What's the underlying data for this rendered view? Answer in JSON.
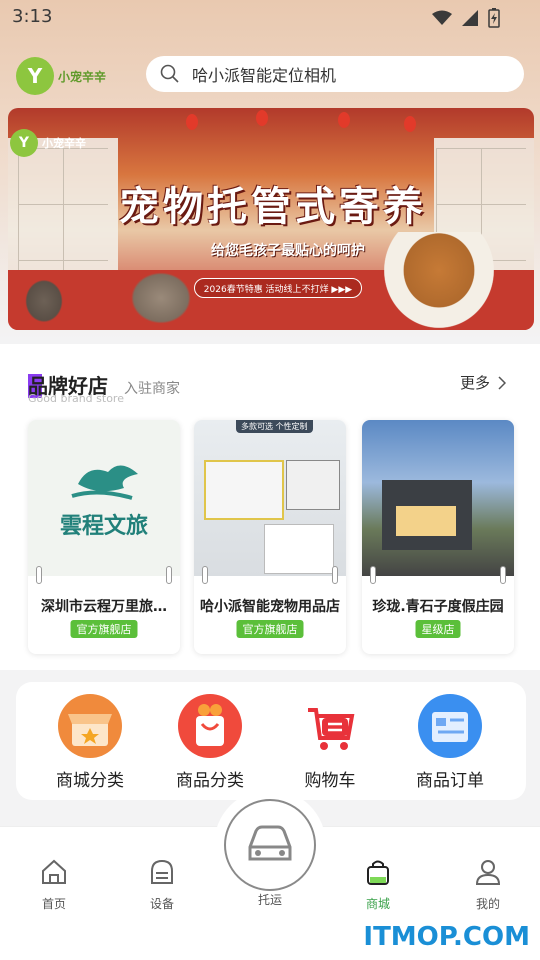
{
  "status_bar": {
    "time": "3:13"
  },
  "header": {
    "logo_text": "小宠辛辛",
    "search_text": "哈小派智能定位相机"
  },
  "banner": {
    "logo_text": "小宠辛辛",
    "title": "宠物托管式寄养",
    "subtitle": "给您毛孩子最贴心的呵护",
    "pill": "2026春节特惠 活动线上不打烊 ▶▶▶"
  },
  "brand": {
    "title": "品牌好店",
    "subtitle": "入驻商家",
    "subtitle_en": "Good brand store",
    "more": "更多",
    "stores": [
      {
        "name": "深圳市云程万里旅…",
        "badge": "官方旗舰店",
        "image_text": "雲程文旅"
      },
      {
        "name": "哈小派智能宠物用品店",
        "badge": "官方旗舰店",
        "image_text": "多款可选 个性定制"
      },
      {
        "name": "珍珑.青石子度假庄园",
        "badge": "星级店",
        "image_text": ""
      }
    ]
  },
  "categories": [
    {
      "label": "商城分类",
      "icon": "store-icon",
      "color": "#f07a3a"
    },
    {
      "label": "商品分类",
      "icon": "gift-bag-icon",
      "color": "#f25a3c"
    },
    {
      "label": "购物车",
      "icon": "cart-icon",
      "color": "#e8323a"
    },
    {
      "label": "商品订单",
      "icon": "order-doc-icon",
      "color": "#3a8ff0"
    }
  ],
  "tabbar": {
    "items": [
      {
        "label": "首页",
        "icon": "home-icon",
        "active": false
      },
      {
        "label": "设备",
        "icon": "device-icon",
        "active": false
      },
      {
        "label": "托运",
        "icon": "car-icon",
        "active": false
      },
      {
        "label": "商城",
        "icon": "shop-bag-icon",
        "active": true
      },
      {
        "label": "我的",
        "icon": "user-icon",
        "active": false
      }
    ]
  },
  "watermark": "ITMOP.COM",
  "colors": {
    "accent_green": "#3aa24a",
    "badge_green": "#5bbf3a",
    "brand_purple": "#8a3cf0"
  }
}
